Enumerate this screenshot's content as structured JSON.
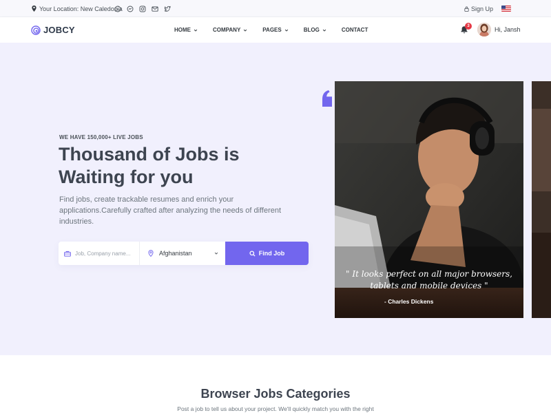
{
  "topbar": {
    "location_text": "Your Location: New Caledonia",
    "social_icons": [
      "whatsapp-icon",
      "messenger-icon",
      "instagram-icon",
      "mail-icon",
      "twitter-icon"
    ],
    "signup_label": "Sign Up",
    "language_flag": "us-flag-icon"
  },
  "navbar": {
    "logo_text": "JOBCY",
    "menu": [
      {
        "label": "HOME",
        "has_dropdown": true
      },
      {
        "label": "COMPANY",
        "has_dropdown": true
      },
      {
        "label": "PAGES",
        "has_dropdown": true
      },
      {
        "label": "BLOG",
        "has_dropdown": true
      },
      {
        "label": "CONTACT",
        "has_dropdown": false
      }
    ],
    "notification_count": "3",
    "greeting": "Hi, Jansh"
  },
  "hero": {
    "subtitle": "WE HAVE 150,000+ LIVE JOBS",
    "headline": "Thousand of Jobs is Waiting for you",
    "description": "Find jobs, create trackable resumes and enrich your applications.Carefully crafted after analyzing the needs of different industries.",
    "search": {
      "placeholder": "Job, Company name...",
      "country_selected": "Afghanistan",
      "button_label": "Find Job"
    },
    "quote": {
      "text": "\" It looks perfect on all major browsers, tablets and mobile devices \"",
      "author": "- Charles Dickens"
    }
  },
  "categories": {
    "title": "Browser Jobs Categories",
    "subtitle": "Post a job to tell us about your project. We'll quickly match you with the right"
  },
  "colors": {
    "accent": "#7266ee",
    "hero_bg": "#f1f0fd",
    "heading": "#3d4450",
    "badge": "#e63946"
  }
}
